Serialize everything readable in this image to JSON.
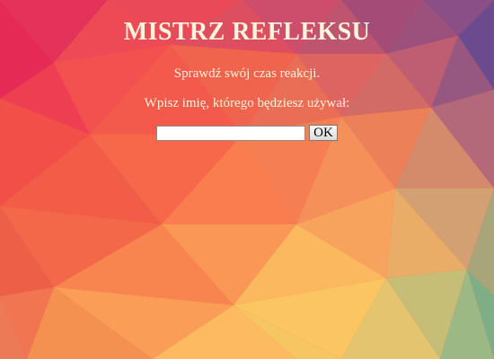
{
  "page": {
    "title": "MISTRZ REFLEKSU",
    "subtitle": "Sprawdź swój czas reakcji.",
    "prompt": "Wpisz imię, którego będziesz używał:"
  },
  "form": {
    "name_value": "",
    "ok_label": "OK"
  },
  "colors": {
    "text": "#fff4dd",
    "palette": [
      "#e8294f",
      "#f25f4c",
      "#fa8e50",
      "#f9c561",
      "#c9b57a",
      "#6f4c8e",
      "#8fb883"
    ]
  }
}
